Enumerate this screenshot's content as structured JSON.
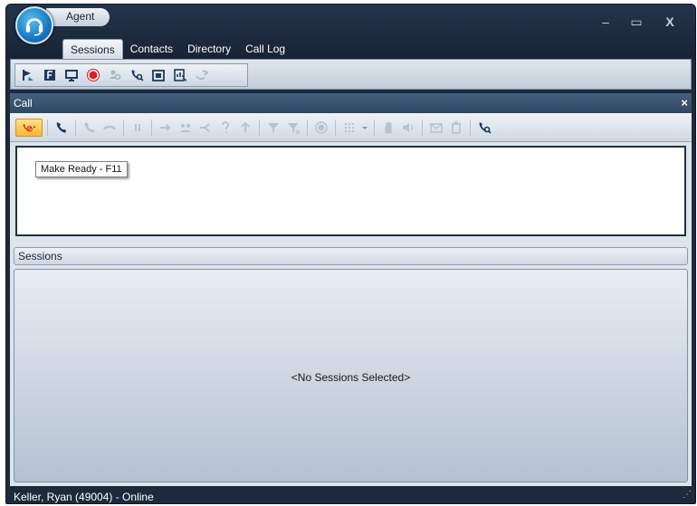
{
  "window": {
    "title": "Agent",
    "controls": {
      "minimize": "–",
      "maximize": "▭",
      "close": "X"
    }
  },
  "tabs": [
    {
      "label": "Sessions",
      "active": true
    },
    {
      "label": "Contacts",
      "active": false
    },
    {
      "label": "Directory",
      "active": false
    },
    {
      "label": "Call Log",
      "active": false
    }
  ],
  "ribbon": {
    "icons": [
      "agent-flag-icon",
      "f-key-icon",
      "monitor-icon",
      "record-icon",
      "search-person-icon",
      "phone-search-icon",
      "calendar-icon",
      "report-icon",
      "transfer-icon"
    ]
  },
  "call_panel": {
    "title": "Call",
    "close_label": "×",
    "toolbar_icons": [
      "make-ready-icon",
      "dropdown-icon",
      "phone-icon",
      "phone-dim-icon",
      "hold-icon",
      "pause-icon",
      "forward-icon",
      "conference-icon",
      "split-icon",
      "help-icon",
      "upload-icon",
      "filter-icon",
      "filter-x-icon",
      "record-icon",
      "keypad-icon",
      "dropdown-icon",
      "hand-icon",
      "volume-icon",
      "mail-icon",
      "trash-icon",
      "phone-search-icon"
    ],
    "tooltip": "Make Ready - F11"
  },
  "sessions_panel": {
    "title": "Sessions",
    "empty_text": "<No Sessions Selected>"
  },
  "statusbar": {
    "text": "Keller, Ryan (49004)  - Online"
  },
  "colors": {
    "frame": "#1c2a3c",
    "accent": "#1678c0",
    "highlight": "#f7b733",
    "record": "#e02020"
  }
}
